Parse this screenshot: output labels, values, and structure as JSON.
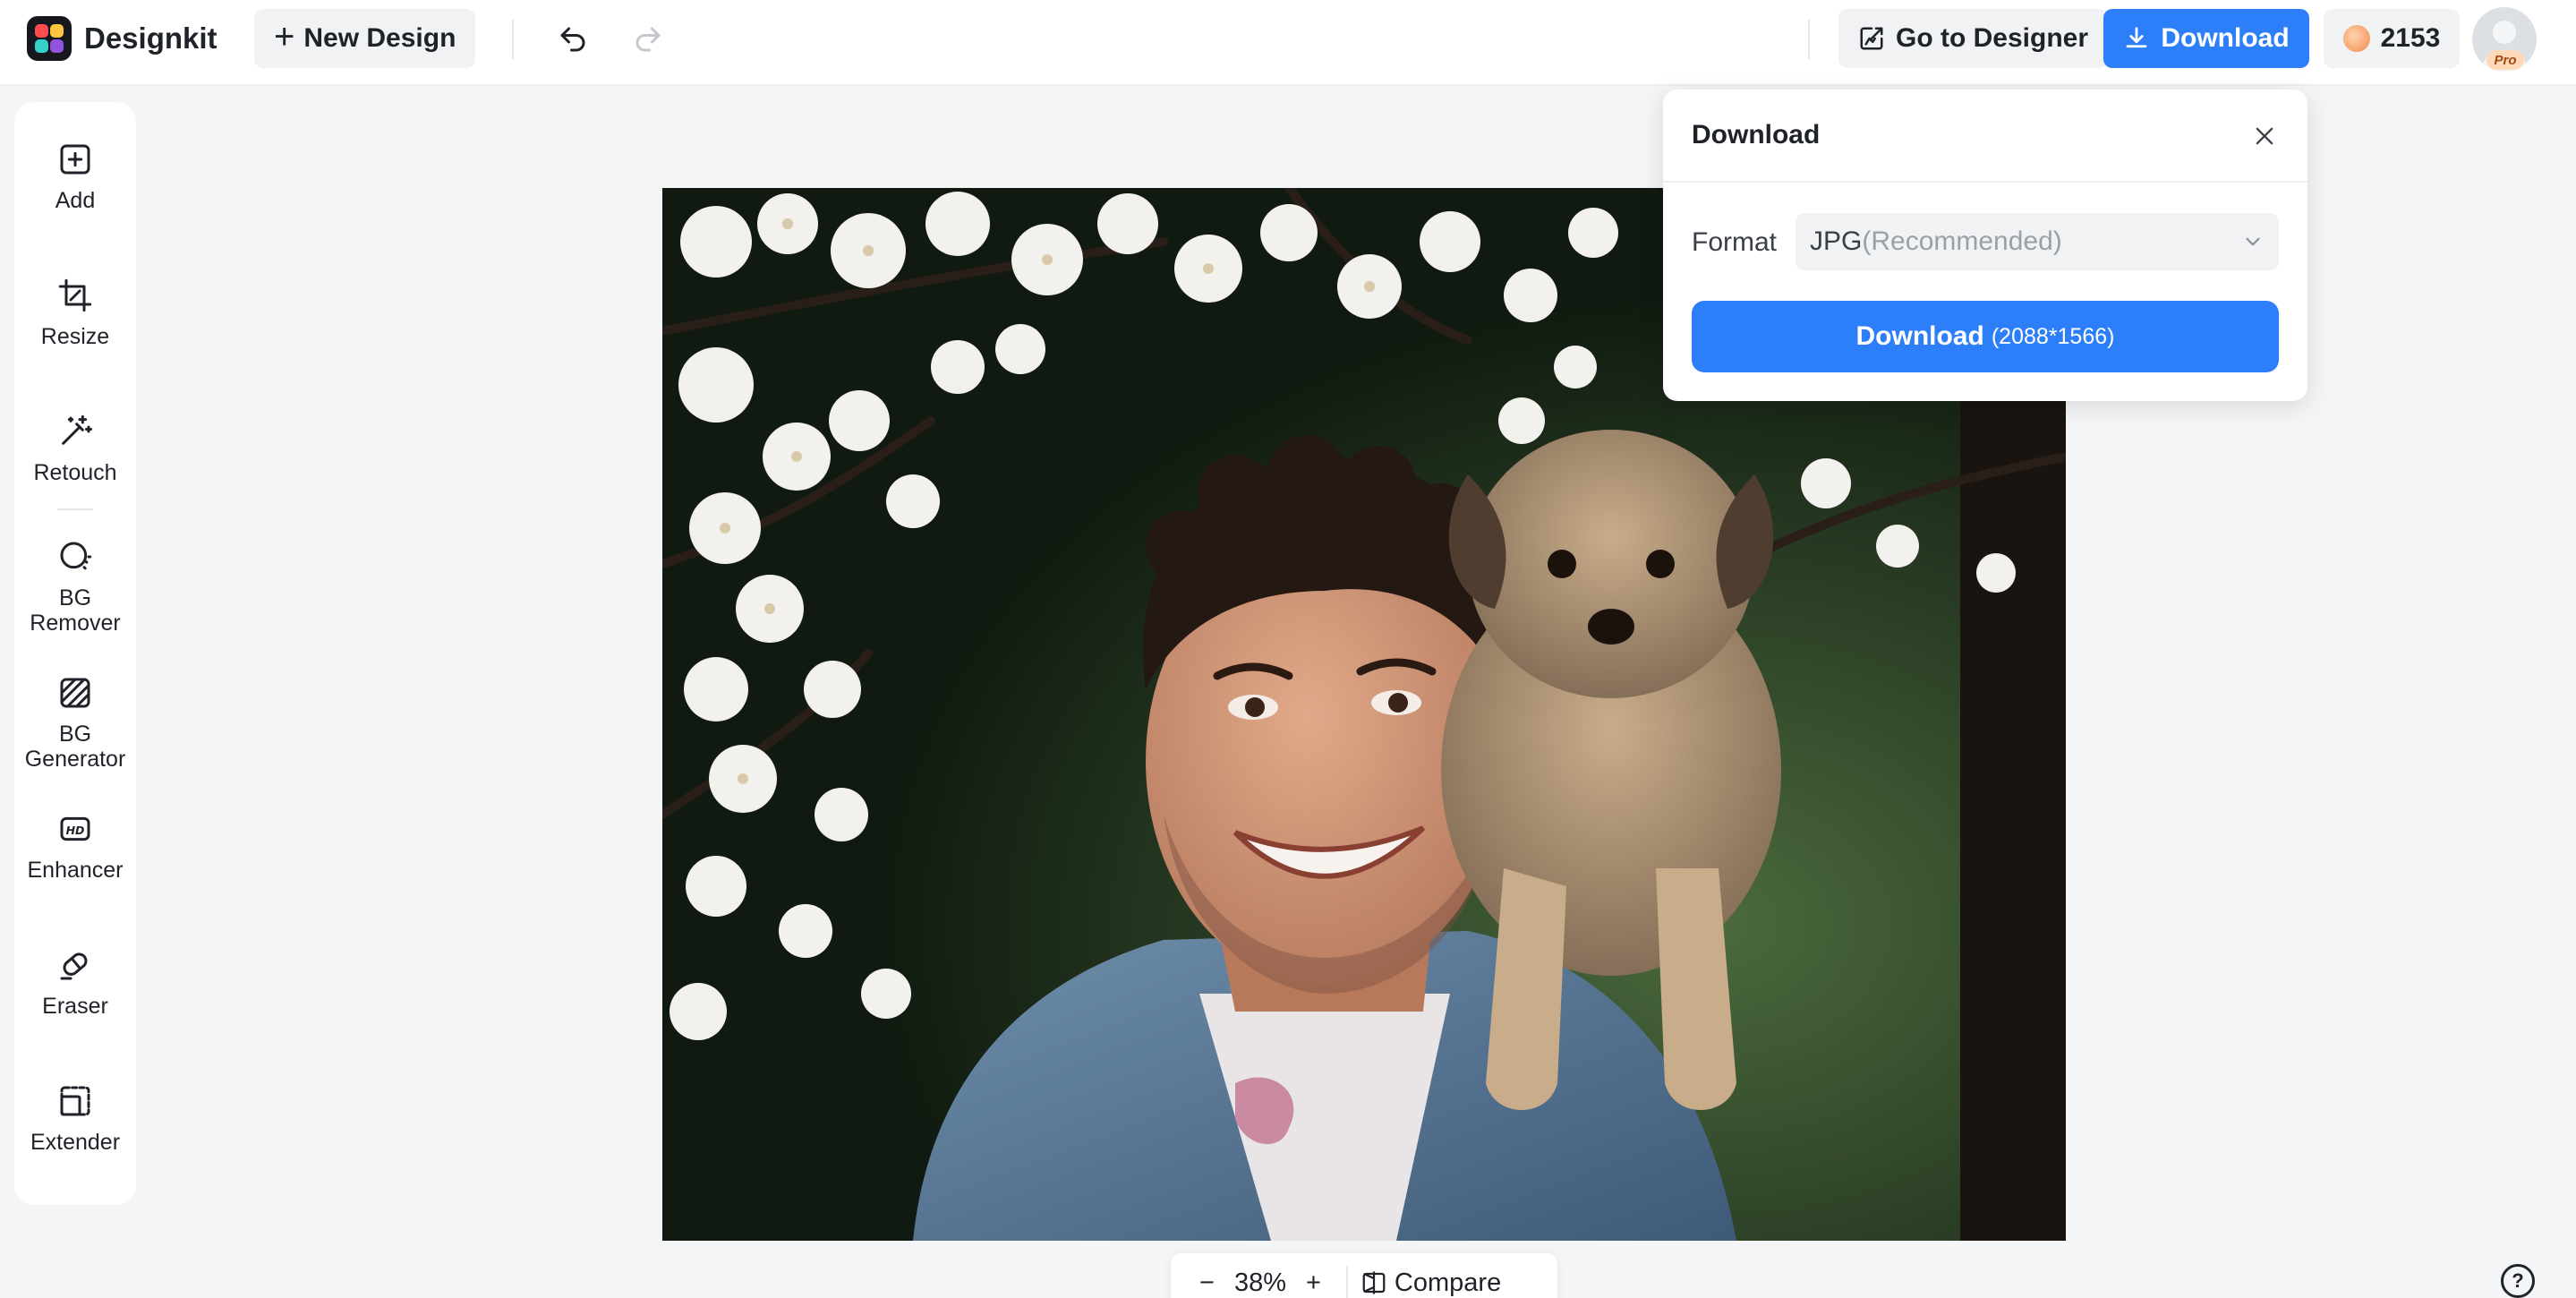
{
  "app": {
    "name": "Designkit",
    "brand_colors": [
      "#ff4d4f",
      "#ffc53d",
      "#36cfc9",
      "#9254de"
    ],
    "accent": "#2d7ff9"
  },
  "header": {
    "new_design_label": "New Design",
    "undo_icon": "undo-icon",
    "redo_icon": "redo-icon",
    "go_to_designer_label": "Go to Designer",
    "download_label": "Download",
    "credits": "2153",
    "pro_badge": "Pro"
  },
  "tools": [
    {
      "id": "add",
      "label": "Add",
      "icon": "add-square-icon"
    },
    {
      "id": "resize",
      "label": "Resize",
      "icon": "crop-icon"
    },
    {
      "id": "retouch",
      "label": "Retouch",
      "icon": "magic-wand-icon"
    },
    {
      "id": "bg-remover",
      "label": "BG Remover",
      "icon": "bg-remover-icon"
    },
    {
      "id": "bg-generator",
      "label": "BG Generator",
      "icon": "bg-generator-icon"
    },
    {
      "id": "enhancer",
      "label": "Enhancer",
      "icon": "hd-icon"
    },
    {
      "id": "eraser",
      "label": "Eraser",
      "icon": "eraser-icon"
    },
    {
      "id": "extender",
      "label": "Extender",
      "icon": "extender-icon"
    }
  ],
  "zoom": {
    "minus": "−",
    "level": "38%",
    "plus": "+",
    "compare_label": "Compare"
  },
  "help_label": "?",
  "download_panel": {
    "title": "Download",
    "format_label": "Format",
    "format_value": "JPG",
    "format_hint": "(Recommended)",
    "button_label": "Download",
    "button_size": "(2088*1566)"
  }
}
